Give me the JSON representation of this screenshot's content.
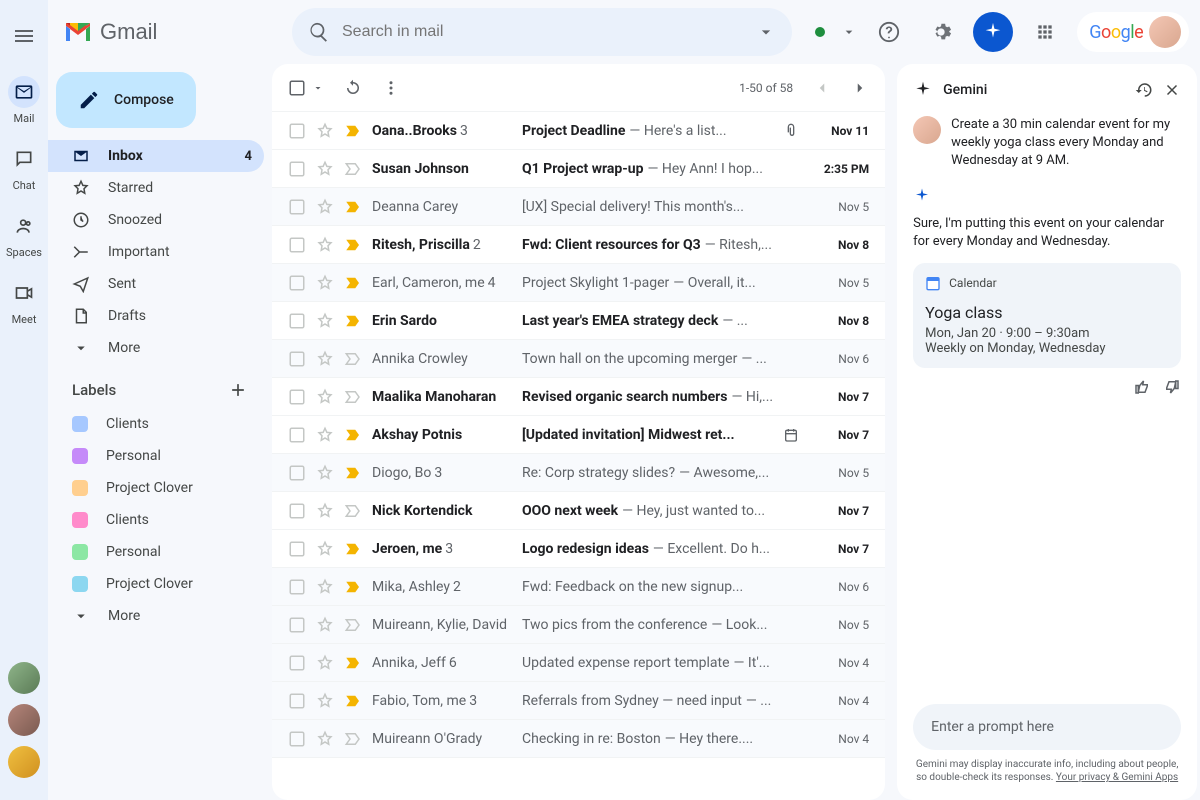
{
  "app_name": "Gmail",
  "search_placeholder": "Search in mail",
  "google_label": "Google",
  "rail": [
    {
      "label": "Mail"
    },
    {
      "label": "Chat"
    },
    {
      "label": "Spaces"
    },
    {
      "label": "Meet"
    }
  ],
  "compose_label": "Compose",
  "nav": [
    {
      "label": "Inbox",
      "count": "4"
    },
    {
      "label": "Starred"
    },
    {
      "label": "Snoozed"
    },
    {
      "label": "Important"
    },
    {
      "label": "Sent"
    },
    {
      "label": "Drafts"
    },
    {
      "label": "More"
    }
  ],
  "labels_heading": "Labels",
  "labels": [
    {
      "label": "Clients",
      "color": "#a6c8ff"
    },
    {
      "label": "Personal",
      "color": "#c58af9"
    },
    {
      "label": "Project Clover",
      "color": "#ffcf8f"
    },
    {
      "label": "Clients",
      "color": "#ff8bcb"
    },
    {
      "label": "Personal",
      "color": "#8ce7a4"
    },
    {
      "label": "Project Clover",
      "color": "#8cd7f0"
    },
    {
      "label": "More"
    }
  ],
  "page_count": "1-50 of 58",
  "emails": [
    {
      "from": "Oana..Brooks",
      "count": "3",
      "subject": "Project Deadline",
      "snippet": " —  Here's a list...",
      "date": "Nov 11",
      "unread": true,
      "imp": true,
      "att": true
    },
    {
      "from": "Susan Johnson",
      "subject": "Q1 Project wrap-up",
      "snippet": " — Hey Ann! I hop...",
      "date": "2:35 PM",
      "unread": true,
      "imp": false
    },
    {
      "from": "Deanna Carey",
      "subject": "[UX] Special delivery! This month's...",
      "snippet": "",
      "date": "Nov 5",
      "unread": false,
      "imp": true
    },
    {
      "from": "Ritesh, Priscilla",
      "count": "2",
      "subject": "Fwd: Client resources for Q3",
      "snippet": " — Ritesh,...",
      "date": "Nov 8",
      "unread": true,
      "imp": true
    },
    {
      "from": "Earl, Cameron, me",
      "count": "4",
      "subject": "Project Skylight 1-pager",
      "snippet": " — Overall, it...",
      "date": "Nov 5",
      "unread": false,
      "imp": true
    },
    {
      "from": "Erin Sardo",
      "subject": "Last year's EMEA strategy deck",
      "snippet": " — ...",
      "date": "Nov 8",
      "unread": true,
      "imp": true
    },
    {
      "from": "Annika Crowley",
      "subject": "Town hall on the upcoming merger",
      "snippet": " — ...",
      "date": "Nov 6",
      "unread": false,
      "imp": false
    },
    {
      "from": "Maalika Manoharan",
      "subject": "Revised organic search numbers",
      "snippet": " — Hi,...",
      "date": "Nov 7",
      "unread": true,
      "imp": false
    },
    {
      "from": "Akshay Potnis",
      "subject": "[Updated invitation] Midwest ret...",
      "snippet": "",
      "date": "Nov 7",
      "unread": true,
      "imp": true,
      "cal": true
    },
    {
      "from": "Diogo, Bo",
      "count": "3",
      "subject": "Re: Corp strategy slides?",
      "snippet": " — Awesome,...",
      "date": "Nov 5",
      "unread": false,
      "imp": true
    },
    {
      "from": "Nick Kortendick",
      "subject": "OOO next week",
      "snippet": " — Hey, just wanted to...",
      "date": "Nov 7",
      "unread": true,
      "imp": false
    },
    {
      "from": "Jeroen, me",
      "count": "3",
      "subject": "Logo redesign ideas",
      "snippet": " — Excellent. Do h...",
      "date": "Nov 7",
      "unread": true,
      "imp": true
    },
    {
      "from": "Mika, Ashley",
      "count": "2",
      "subject": "Fwd: Feedback on the new signup...",
      "snippet": "",
      "date": "Nov 6",
      "unread": false,
      "imp": true
    },
    {
      "from": "Muireann, Kylie, David",
      "subject": "Two pics from the conference",
      "snippet": " — Look...",
      "date": "Nov 5",
      "unread": false,
      "imp": false
    },
    {
      "from": "Annika, Jeff",
      "count": "6",
      "subject": "Updated expense report template",
      "snippet": " — It'...",
      "date": "Nov 4",
      "unread": false,
      "imp": true
    },
    {
      "from": "Fabio, Tom, me",
      "count": "3",
      "subject": "Referrals from Sydney — need input",
      "snippet": " — ...",
      "date": "Nov 4",
      "unread": false,
      "imp": true
    },
    {
      "from": "Muireann O'Grady",
      "subject": "Checking in re: Boston",
      "snippet": " — Hey there....",
      "date": "Nov 4",
      "unread": false,
      "imp": false
    }
  ],
  "gemini": {
    "title": "Gemini",
    "user_prompt": "Create a 30 min calendar event for my weekly yoga class every Monday and Wednesday at 9 AM.",
    "response": "Sure, I'm putting this event on your calendar for every Monday and Wednesday.",
    "card_app": "Calendar",
    "event_title": "Yoga class",
    "event_time": "Mon, Jan 20 · 9:00 – 9:30am",
    "event_recur": "Weekly on Monday, Wednesday",
    "input_placeholder": "Enter a prompt here",
    "disclaimer": "Gemini may display inaccurate info, including about people, so double-check its responses. ",
    "disclaimer_link": "Your privacy & Gemini Apps"
  }
}
